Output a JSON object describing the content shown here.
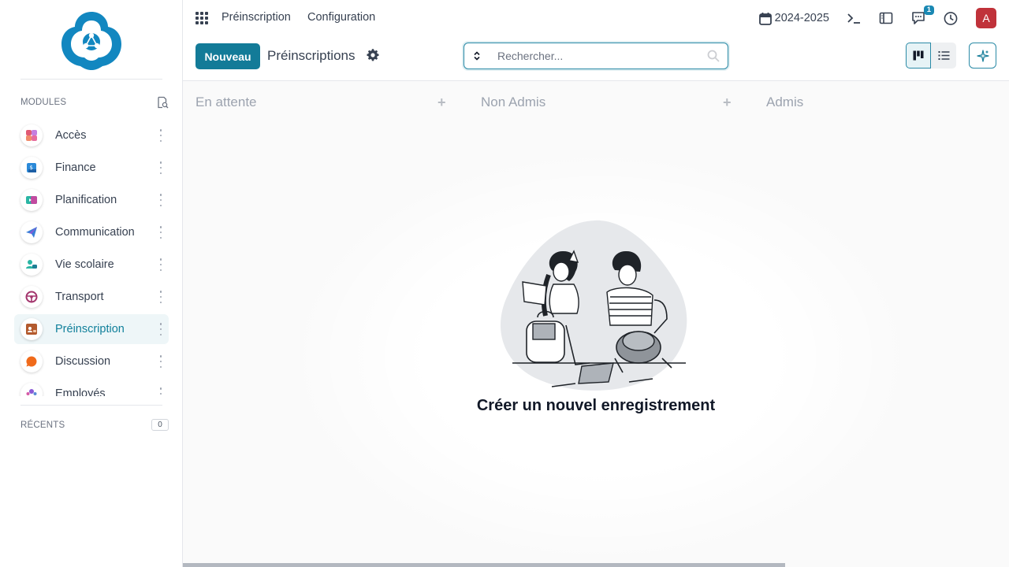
{
  "sidebar": {
    "modules_title": "MODULES",
    "recents_title": "RÉCENTS",
    "recents_count": "0",
    "items": [
      {
        "label": "Accès",
        "icon": "access-icon"
      },
      {
        "label": "Finance",
        "icon": "finance-icon"
      },
      {
        "label": "Planification",
        "icon": "planning-icon"
      },
      {
        "label": "Communication",
        "icon": "paper-plane-icon"
      },
      {
        "label": "Vie scolaire",
        "icon": "school-life-icon"
      },
      {
        "label": "Transport",
        "icon": "steering-wheel-icon"
      },
      {
        "label": "Préinscription",
        "icon": "preregistration-icon",
        "active": true
      },
      {
        "label": "Discussion",
        "icon": "chat-bubble-icon"
      },
      {
        "label": "Employés",
        "icon": "employees-icon"
      }
    ]
  },
  "topbar": {
    "menu": [
      "Préinscription",
      "Configuration"
    ],
    "year": "2024-2025",
    "notifications_count": "1",
    "avatar_letter": "A"
  },
  "controls": {
    "new_label": "Nouveau",
    "title": "Préinscriptions",
    "search_placeholder": "Rechercher..."
  },
  "kanban": {
    "columns": [
      "En attente",
      "Non Admis",
      "Admis"
    ],
    "empty_title": "Créer un nouvel enregistrement"
  },
  "colors": {
    "accent": "#137b98",
    "active_text": "#11809b",
    "avatar": "#c0323a",
    "badge": "#1a88b3"
  }
}
